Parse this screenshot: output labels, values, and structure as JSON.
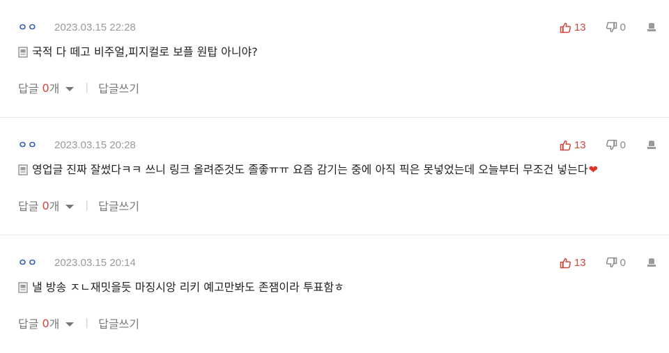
{
  "colors": {
    "author": "#3a5ea8",
    "upvote": "#d2443a",
    "downvote": "#8a8a8a",
    "reply_count": "#d2443a",
    "heart": "#e0322a"
  },
  "icons": {
    "upvote": "thumbs-up-icon",
    "downvote": "thumbs-down-icon",
    "report": "report-icon",
    "content": "document-icon",
    "caret": "chevron-down-icon"
  },
  "comments": [
    {
      "author": "ㅇㅇ",
      "date": "2023.03.15 22:28",
      "upvotes": "13",
      "downvotes": "0",
      "text": "국적 다 떼고 비주얼,피지컬로 보플 원탑 아니야?",
      "emoji": "",
      "reply_label": "답글",
      "reply_count": "0",
      "reply_unit": "개",
      "write_reply_label": "답글쓰기"
    },
    {
      "author": "ㅇㅇ",
      "date": "2023.03.15 20:28",
      "upvotes": "13",
      "downvotes": "0",
      "text": "영업글 진짜 잘썼다ㅋㅋ 쓰니 링크 올려준것도 졸좋ㅠㅠ 요즘 감기는 중에 아직 픽은 못넣었는데 오늘부터 무조건 넣는다",
      "emoji": "❤",
      "reply_label": "답글",
      "reply_count": "0",
      "reply_unit": "개",
      "write_reply_label": "답글쓰기"
    },
    {
      "author": "ㅇㅇ",
      "date": "2023.03.15 20:14",
      "upvotes": "13",
      "downvotes": "0",
      "text": "낼 방송 ㅈㄴ재밋을듯 마징시앙 리키 예고만봐도 존잼이라 투표함ㅎ",
      "emoji": "",
      "reply_label": "답글",
      "reply_count": "0",
      "reply_unit": "개",
      "write_reply_label": "답글쓰기"
    }
  ]
}
